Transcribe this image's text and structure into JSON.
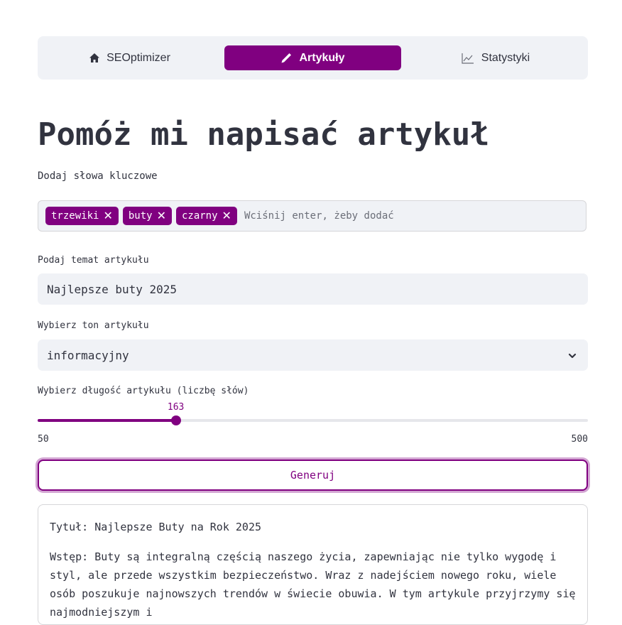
{
  "nav": {
    "items": [
      {
        "label": "SEOptimizer",
        "icon": "home-icon"
      },
      {
        "label": "Artykuły",
        "icon": "pencil-icon",
        "active": true
      },
      {
        "label": "Statystyki",
        "icon": "chart-line-icon"
      }
    ]
  },
  "page": {
    "title": "Pomóż mi napisać artykuł"
  },
  "keywords": {
    "label": "Dodaj słowa kluczowe",
    "tags": [
      "trzewiki",
      "buty",
      "czarny"
    ],
    "placeholder": "Wciśnij enter, żeby dodać"
  },
  "topic": {
    "label": "Podaj temat artykułu",
    "value": "Najlepsze buty 2025"
  },
  "tone": {
    "label": "Wybierz ton artykułu",
    "selected": "informacyjny"
  },
  "length": {
    "label": "Wybierz długość artykułu (liczbę słów)",
    "value": 163,
    "min": 50,
    "max": 500,
    "value_text": "163",
    "min_text": "50",
    "max_text": "500"
  },
  "generate": {
    "label": "Generuj"
  },
  "output": {
    "title": "Tytuł: Najlepsze Buty na Rok 2025",
    "intro": "Wstęp: Buty są integralną częścią naszego życia, zapewniając nie tylko wygodę i styl, ale przede wszystkim bezpieczeństwo. Wraz z nadejściem nowego roku, wiele osób poszukuje najnowszych trendów w świecie obuwia. W tym artykule przyjrzymy się najmodniejszym i"
  },
  "colors": {
    "accent": "#800080",
    "surface": "#f0f2f6",
    "text": "#31333f"
  }
}
